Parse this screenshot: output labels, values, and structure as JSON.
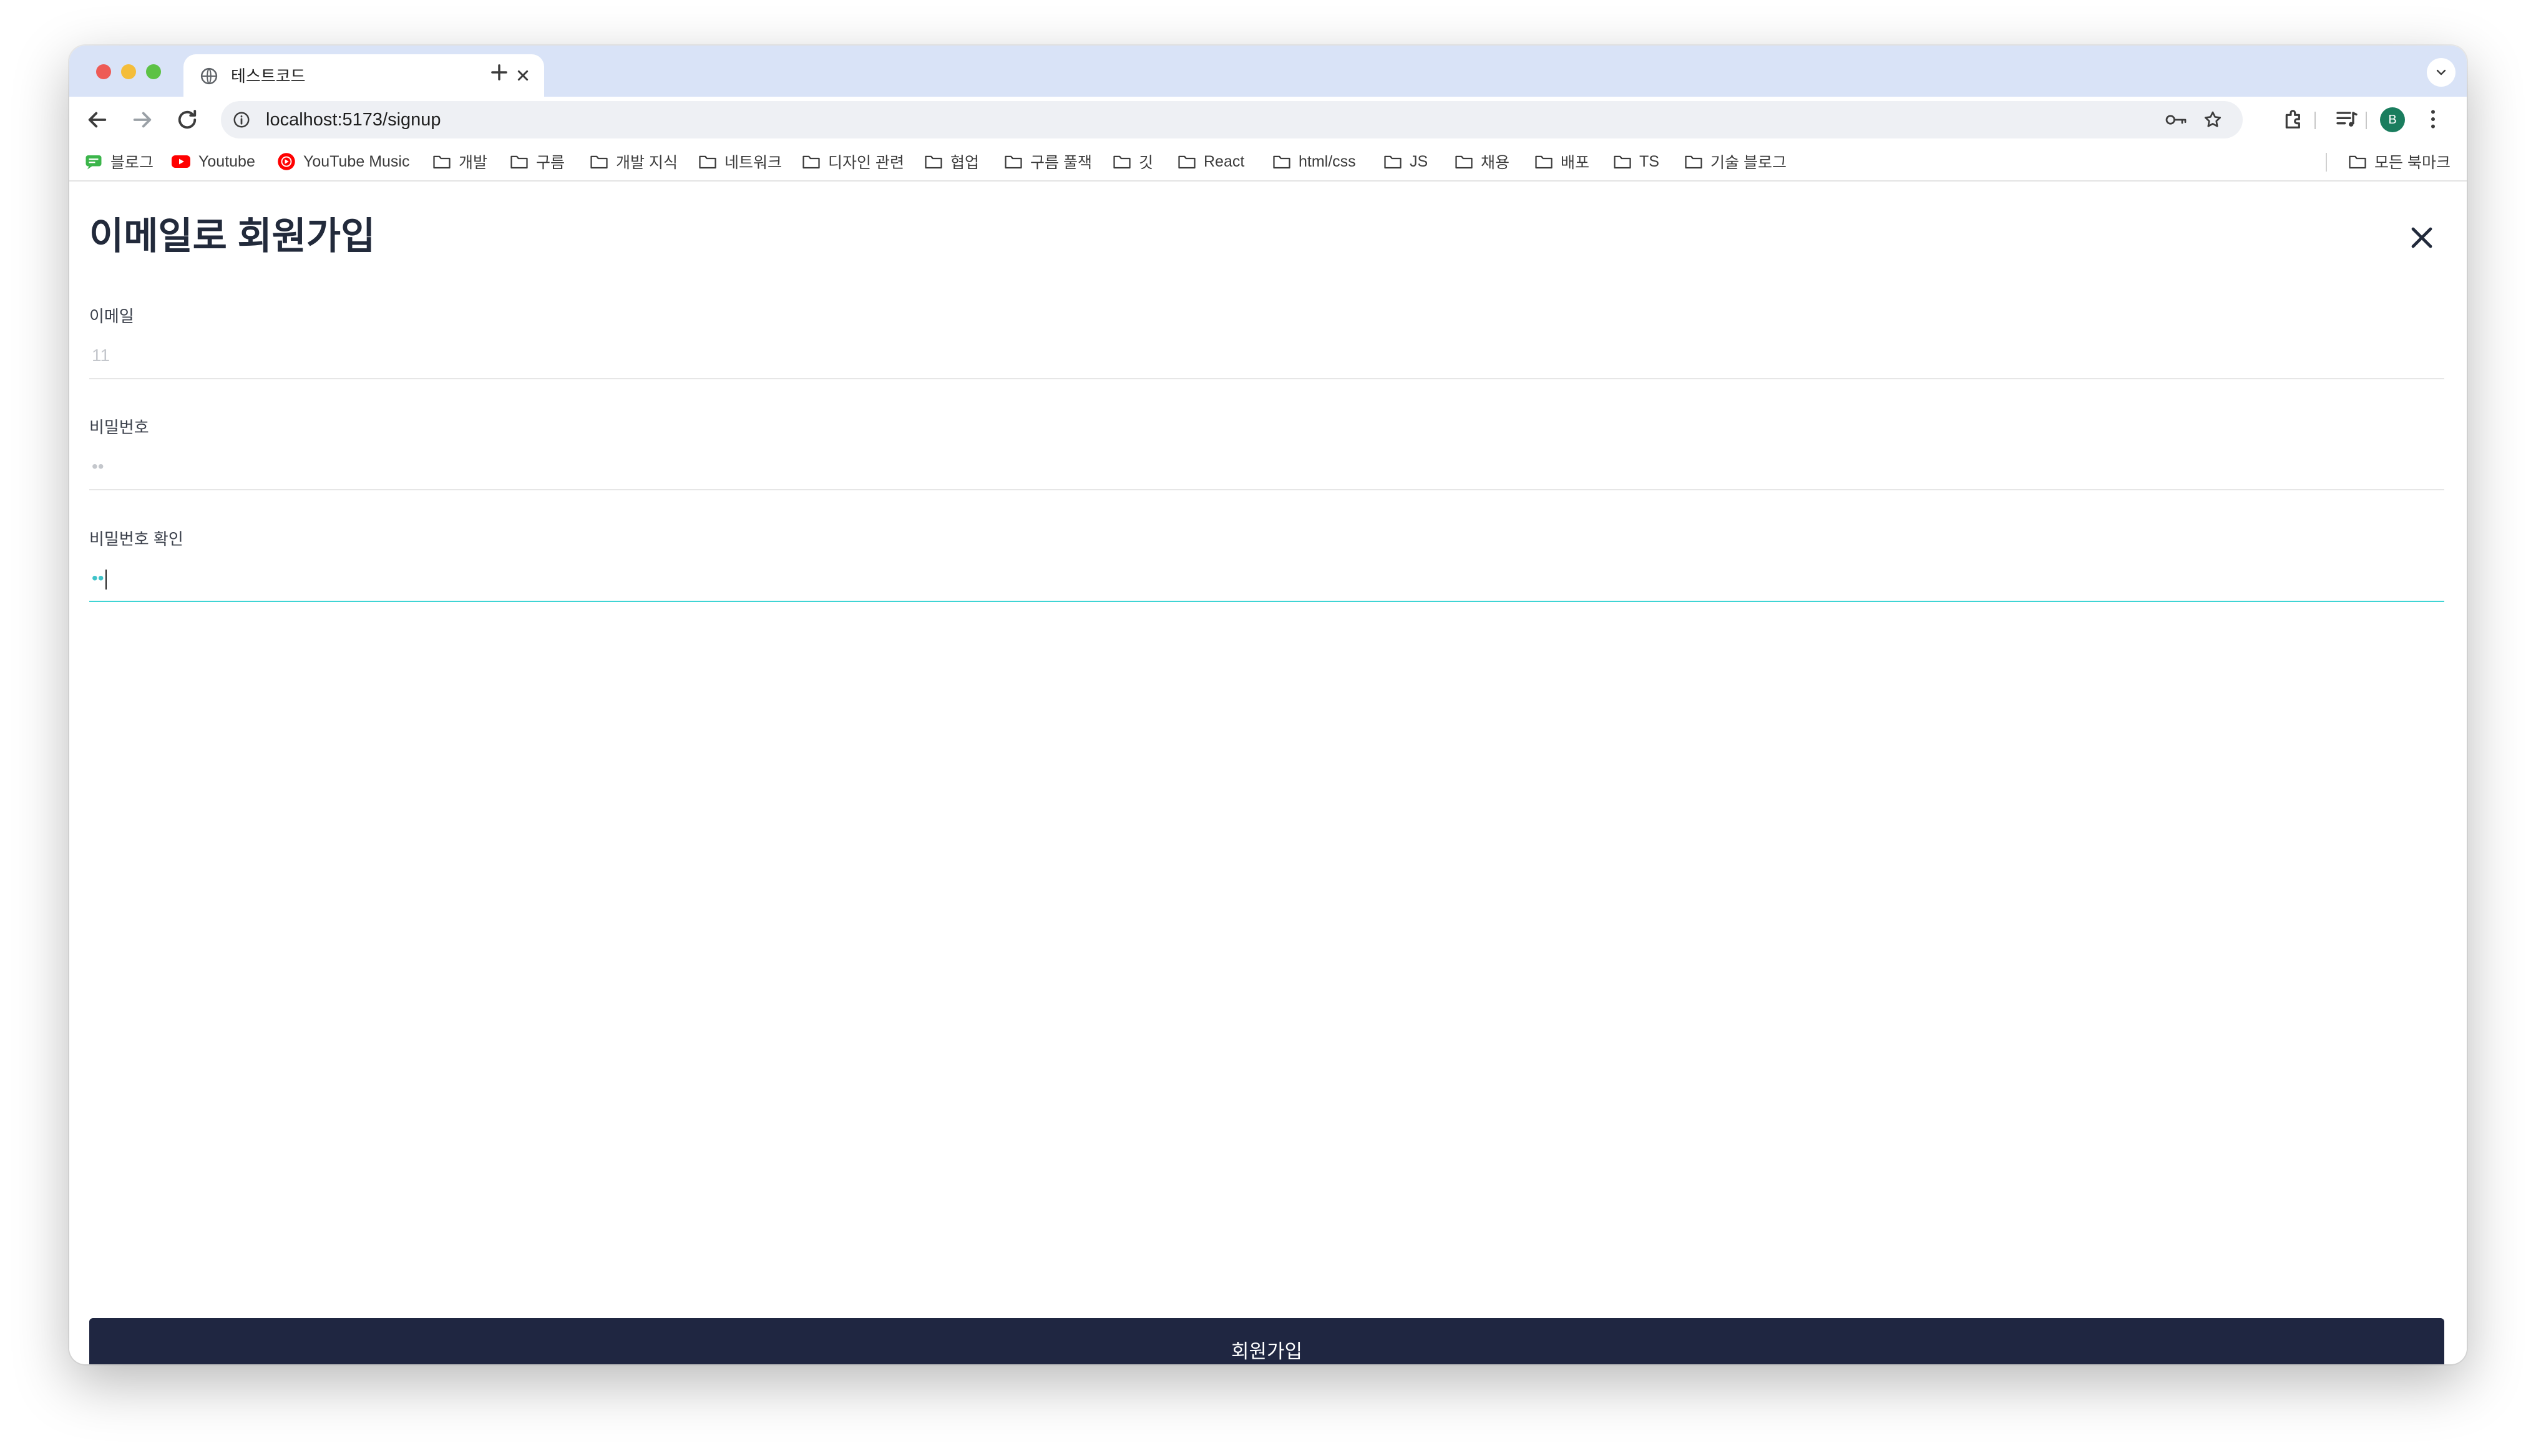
{
  "browser": {
    "tab_title": "테스트코드",
    "url": "localhost:5173/signup",
    "profile_initial": "B"
  },
  "bookmarks": [
    {
      "label": "블로그",
      "icon": "green-chat-icon"
    },
    {
      "label": "Youtube",
      "icon": "youtube-icon"
    },
    {
      "label": "YouTube Music",
      "icon": "youtube-music-icon"
    },
    {
      "label": "개발",
      "icon": "folder-icon"
    },
    {
      "label": "구름",
      "icon": "folder-icon"
    },
    {
      "label": "개발 지식",
      "icon": "folder-icon"
    },
    {
      "label": "네트워크",
      "icon": "folder-icon"
    },
    {
      "label": "디자인 관련",
      "icon": "folder-icon"
    },
    {
      "label": "협업",
      "icon": "folder-icon"
    },
    {
      "label": "구름 풀잭",
      "icon": "folder-icon"
    },
    {
      "label": "깃",
      "icon": "folder-icon"
    },
    {
      "label": "React",
      "icon": "folder-icon"
    },
    {
      "label": "html/css",
      "icon": "folder-icon"
    },
    {
      "label": "JS",
      "icon": "folder-icon"
    },
    {
      "label": "채용",
      "icon": "folder-icon"
    },
    {
      "label": "배포",
      "icon": "folder-icon"
    },
    {
      "label": "TS",
      "icon": "folder-icon"
    },
    {
      "label": "기술 블로그",
      "icon": "folder-icon"
    }
  ],
  "all_bookmarks_label": "모든 북마크",
  "page": {
    "title": "이메일로 회원가입",
    "fields": [
      {
        "label": "이메일",
        "value": "11"
      },
      {
        "label": "비밀번호",
        "value": "••"
      },
      {
        "label": "비밀번호 확인",
        "value": "••"
      }
    ],
    "submit_label": "회원가입"
  },
  "colors": {
    "submit_bg": "#1f2641",
    "focus_line": "#3fd4d4",
    "title_text": "#222a3b"
  }
}
